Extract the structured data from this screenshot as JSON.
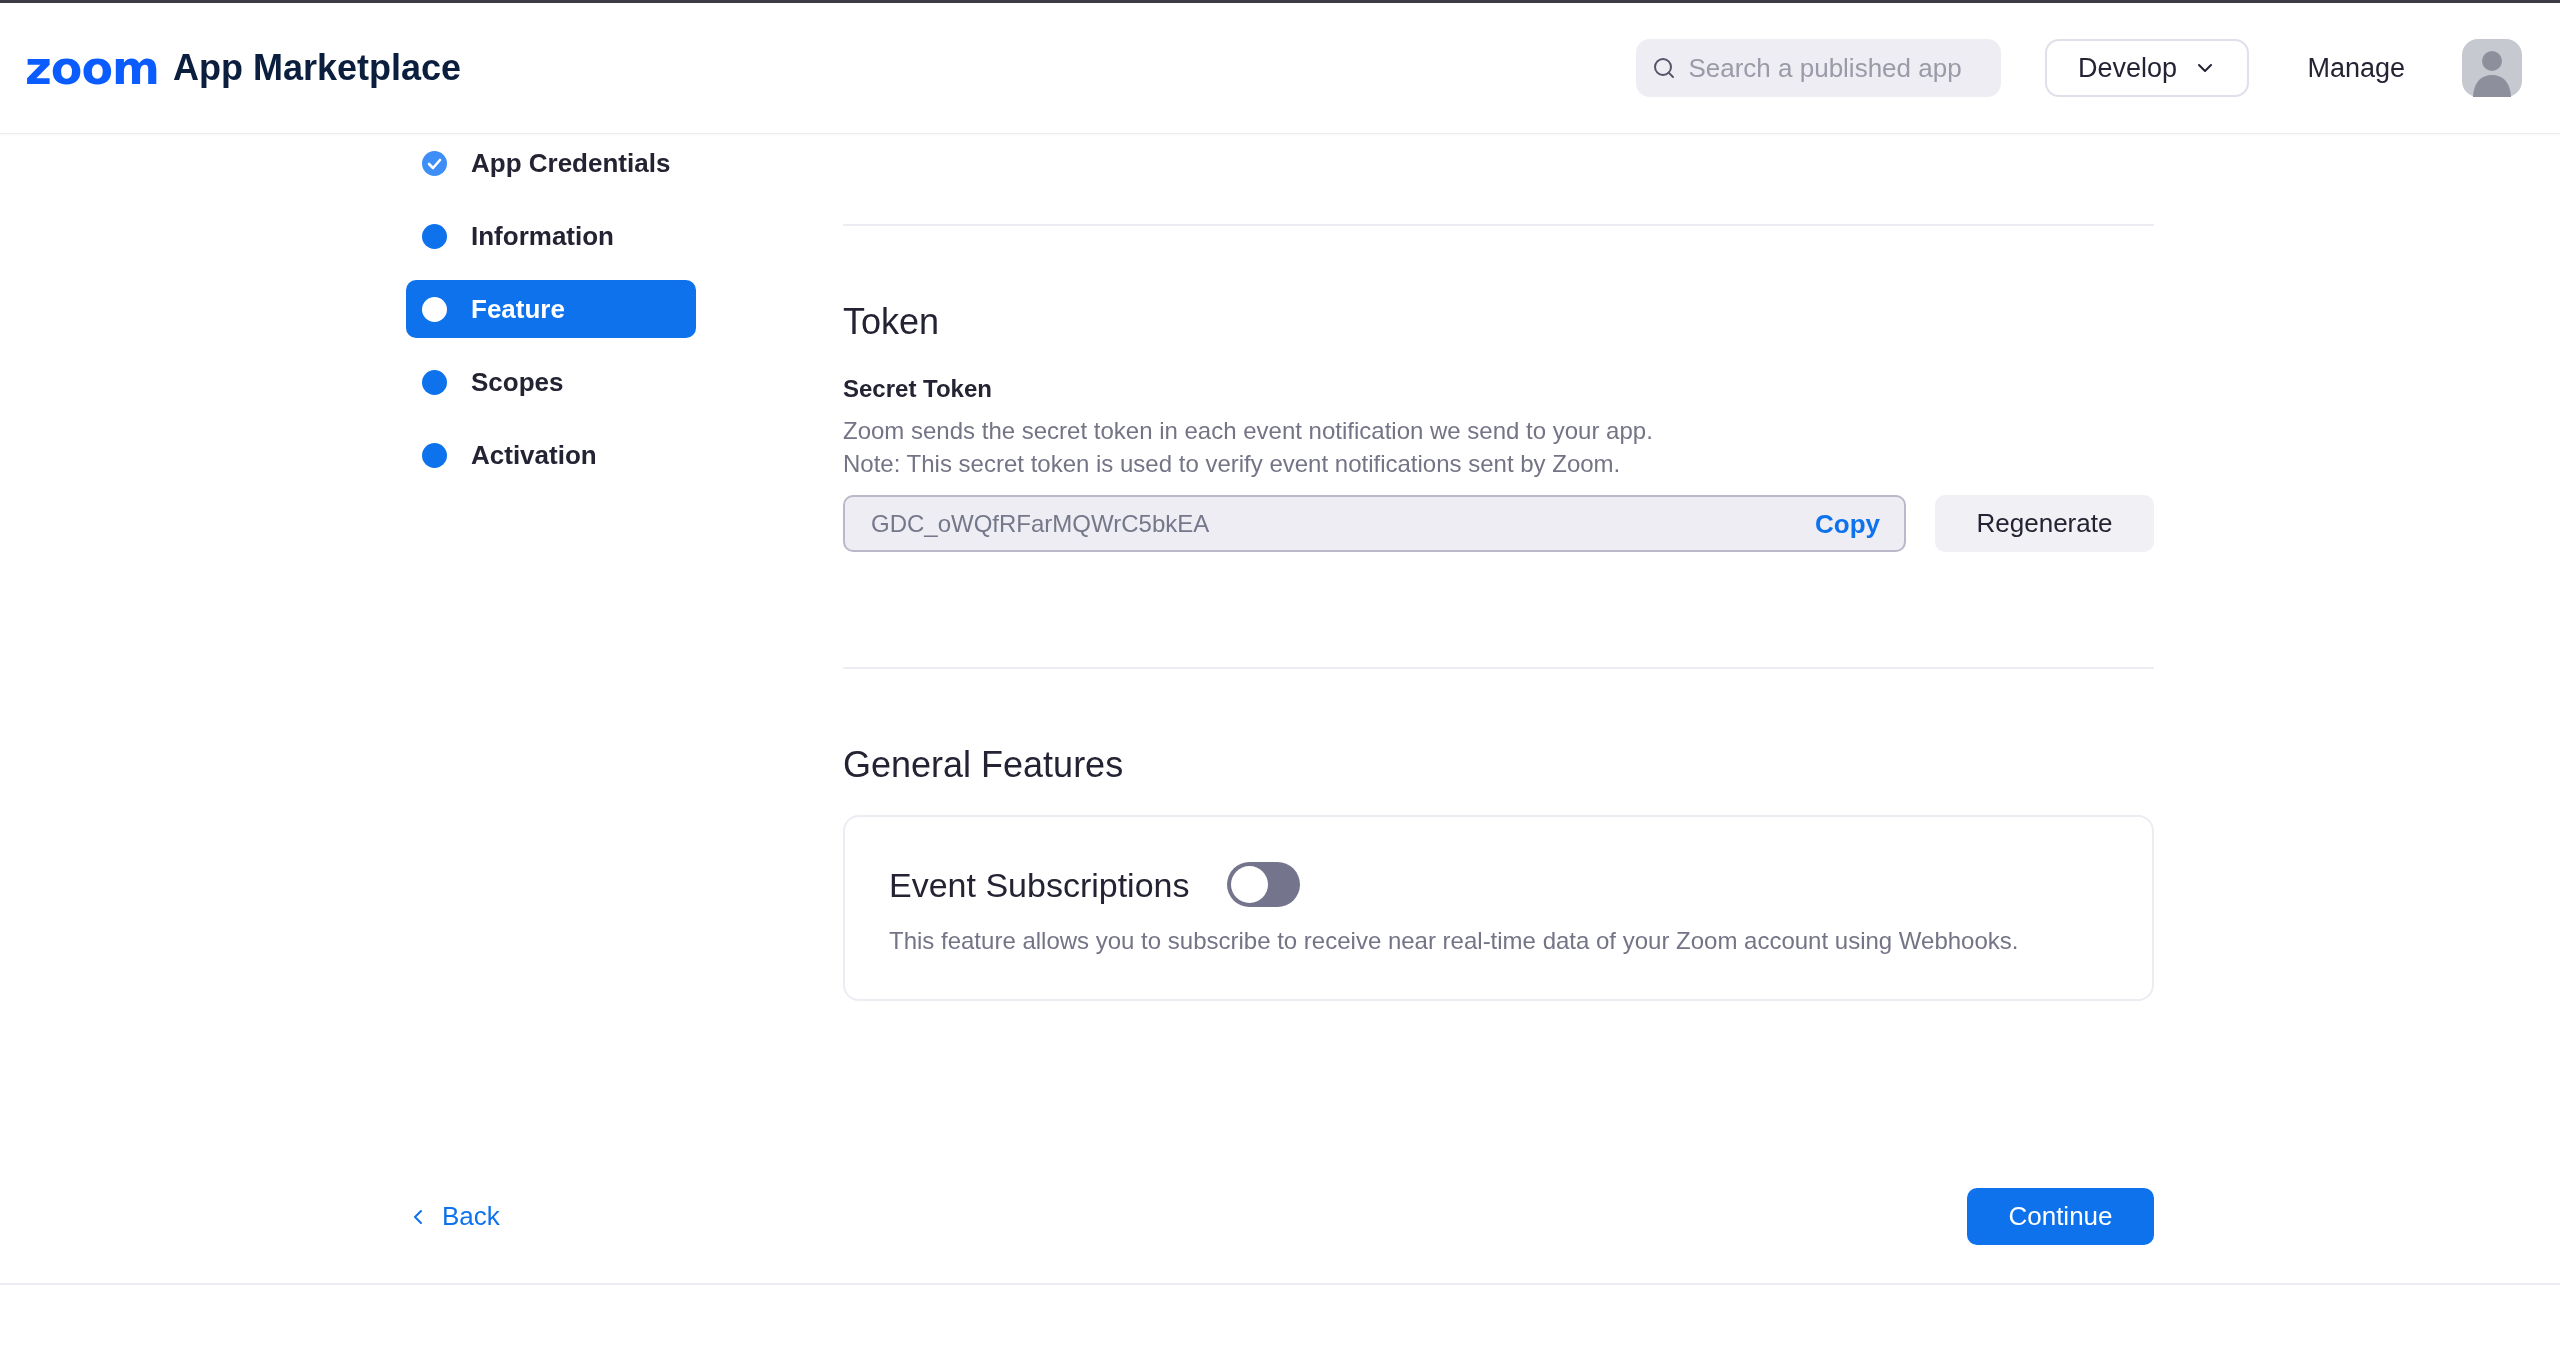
{
  "header": {
    "logo": "zoom",
    "title": "App Marketplace",
    "search": {
      "placeholder": "Search a published app"
    },
    "nav": [
      {
        "kind": "dropdown",
        "label": "Develop"
      },
      {
        "kind": "link",
        "label": "Manage"
      }
    ]
  },
  "steps": [
    {
      "label": "App Credentials",
      "completed": true,
      "selected": false
    },
    {
      "label": "Information",
      "completed": false,
      "selected": false
    },
    {
      "label": "Feature",
      "completed": false,
      "selected": true
    },
    {
      "label": "Scopes",
      "completed": false,
      "selected": false
    },
    {
      "label": "Activation",
      "completed": false,
      "selected": false
    }
  ],
  "token": {
    "heading": "Token",
    "label": "Secret Token",
    "notes": [
      "Zoom sends the secret token in each event notification we send to your app.",
      "Note: This secret token is used to verify event notifications sent by Zoom."
    ],
    "value": "GDC_oWQfRFarMQWrC5bkEA",
    "copy": "Copy",
    "regenerate": "Regenerate"
  },
  "general": {
    "heading": "General Features",
    "features": [
      {
        "name": "Event Subscriptions",
        "on": false,
        "description": "This feature allows you to subscribe to receive near real-time data of your Zoom account using Webhooks."
      }
    ]
  },
  "footer": {
    "back": "Back",
    "continue": "Continue"
  }
}
